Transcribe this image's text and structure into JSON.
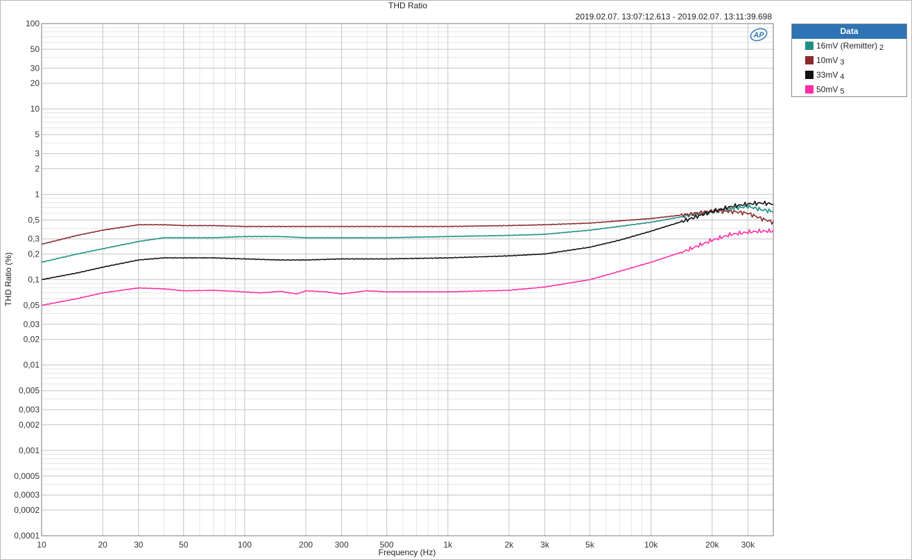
{
  "colors": {
    "grid_major": "#c8c8c8",
    "grid_minor": "#e4e4e4",
    "axis": "#7a7a7a",
    "legend_header": "#2e74b5",
    "ap_logo": "#2e74b5"
  },
  "header": {
    "title": "THD Ratio",
    "timestamp": "2019.02.07. 13:07:12.613 - 2019.02.07. 13:11:39.698",
    "logo_text": "AP"
  },
  "legend": {
    "title": "Data",
    "items": [
      {
        "label": "16mV (Remitter)",
        "index": "2",
        "color": "#1f8f86"
      },
      {
        "label": "10mV",
        "index": "3",
        "color": "#8b2a2a"
      },
      {
        "label": "33mV",
        "index": "4",
        "color": "#111111"
      },
      {
        "label": "50mV",
        "index": "5",
        "color": "#ff2ea6"
      }
    ]
  },
  "chart_data": {
    "type": "line",
    "title": "THD Ratio",
    "xlabel": "Frequency (Hz)",
    "ylabel": "THD Ratio (%)",
    "xscale": "log",
    "yscale": "log",
    "xlim": [
      10,
      40000
    ],
    "ylim": [
      0.0001,
      100
    ],
    "grid": true,
    "legend_position": "right",
    "x_ticks": [
      {
        "v": 10,
        "label": "10"
      },
      {
        "v": 20,
        "label": "20"
      },
      {
        "v": 30,
        "label": "30"
      },
      {
        "v": 50,
        "label": "50"
      },
      {
        "v": 100,
        "label": "100"
      },
      {
        "v": 200,
        "label": "200"
      },
      {
        "v": 300,
        "label": "300"
      },
      {
        "v": 500,
        "label": "500"
      },
      {
        "v": 1000,
        "label": "1k"
      },
      {
        "v": 2000,
        "label": "2k"
      },
      {
        "v": 3000,
        "label": "3k"
      },
      {
        "v": 5000,
        "label": "5k"
      },
      {
        "v": 10000,
        "label": "10k"
      },
      {
        "v": 20000,
        "label": "20k"
      },
      {
        "v": 30000,
        "label": "30k"
      }
    ],
    "y_ticks": [
      {
        "v": 100,
        "label": "100"
      },
      {
        "v": 50,
        "label": "50"
      },
      {
        "v": 30,
        "label": "30"
      },
      {
        "v": 20,
        "label": "20"
      },
      {
        "v": 10,
        "label": "10"
      },
      {
        "v": 5,
        "label": "5"
      },
      {
        "v": 3,
        "label": "3"
      },
      {
        "v": 2,
        "label": "2"
      },
      {
        "v": 1,
        "label": "1"
      },
      {
        "v": 0.5,
        "label": "0,5"
      },
      {
        "v": 0.3,
        "label": "0,3"
      },
      {
        "v": 0.2,
        "label": "0,2"
      },
      {
        "v": 0.1,
        "label": "0,1"
      },
      {
        "v": 0.05,
        "label": "0,05"
      },
      {
        "v": 0.03,
        "label": "0,03"
      },
      {
        "v": 0.02,
        "label": "0,02"
      },
      {
        "v": 0.01,
        "label": "0,01"
      },
      {
        "v": 0.005,
        "label": "0,005"
      },
      {
        "v": 0.003,
        "label": "0,003"
      },
      {
        "v": 0.002,
        "label": "0,002"
      },
      {
        "v": 0.001,
        "label": "0,001"
      },
      {
        "v": 0.0005,
        "label": "0,0005"
      },
      {
        "v": 0.0003,
        "label": "0,0003"
      },
      {
        "v": 0.0002,
        "label": "0,0002"
      },
      {
        "v": 0.0001,
        "label": "0,0001"
      }
    ],
    "series": [
      {
        "name": "16mV (Remitter)",
        "color": "#1f8f86",
        "x": [
          10,
          15,
          20,
          30,
          40,
          50,
          70,
          100,
          150,
          200,
          300,
          500,
          1000,
          2000,
          3000,
          5000,
          10000,
          15000,
          20000,
          25000,
          30000,
          35000,
          40000
        ],
        "y": [
          0.16,
          0.2,
          0.23,
          0.28,
          0.31,
          0.31,
          0.31,
          0.32,
          0.32,
          0.31,
          0.31,
          0.31,
          0.32,
          0.33,
          0.34,
          0.38,
          0.47,
          0.56,
          0.62,
          0.68,
          0.72,
          0.66,
          0.63
        ]
      },
      {
        "name": "10mV",
        "color": "#8b2a2a",
        "x": [
          10,
          15,
          20,
          30,
          40,
          50,
          70,
          100,
          150,
          200,
          300,
          500,
          1000,
          2000,
          3000,
          5000,
          10000,
          15000,
          20000,
          25000,
          30000,
          35000,
          40000
        ],
        "y": [
          0.26,
          0.33,
          0.38,
          0.44,
          0.44,
          0.43,
          0.43,
          0.42,
          0.42,
          0.42,
          0.42,
          0.42,
          0.42,
          0.43,
          0.44,
          0.46,
          0.52,
          0.58,
          0.64,
          0.63,
          0.6,
          0.52,
          0.47
        ]
      },
      {
        "name": "33mV",
        "color": "#111111",
        "x": [
          10,
          15,
          20,
          30,
          40,
          50,
          70,
          100,
          150,
          200,
          300,
          500,
          1000,
          2000,
          3000,
          5000,
          7000,
          10000,
          15000,
          20000,
          25000,
          30000,
          35000,
          40000
        ],
        "y": [
          0.1,
          0.12,
          0.14,
          0.17,
          0.18,
          0.18,
          0.18,
          0.175,
          0.17,
          0.17,
          0.175,
          0.175,
          0.18,
          0.19,
          0.2,
          0.24,
          0.29,
          0.37,
          0.5,
          0.63,
          0.72,
          0.77,
          0.79,
          0.77
        ]
      },
      {
        "name": "50mV",
        "color": "#ff2ea6",
        "x": [
          10,
          15,
          20,
          30,
          40,
          50,
          70,
          100,
          120,
          150,
          180,
          200,
          250,
          300,
          400,
          500,
          1000,
          2000,
          3000,
          5000,
          7000,
          10000,
          15000,
          20000,
          25000,
          30000,
          35000,
          40000
        ],
        "y": [
          0.05,
          0.06,
          0.07,
          0.08,
          0.078,
          0.074,
          0.075,
          0.072,
          0.07,
          0.073,
          0.068,
          0.074,
          0.072,
          0.068,
          0.074,
          0.072,
          0.072,
          0.075,
          0.082,
          0.1,
          0.125,
          0.16,
          0.22,
          0.29,
          0.34,
          0.36,
          0.37,
          0.37
        ]
      }
    ]
  }
}
